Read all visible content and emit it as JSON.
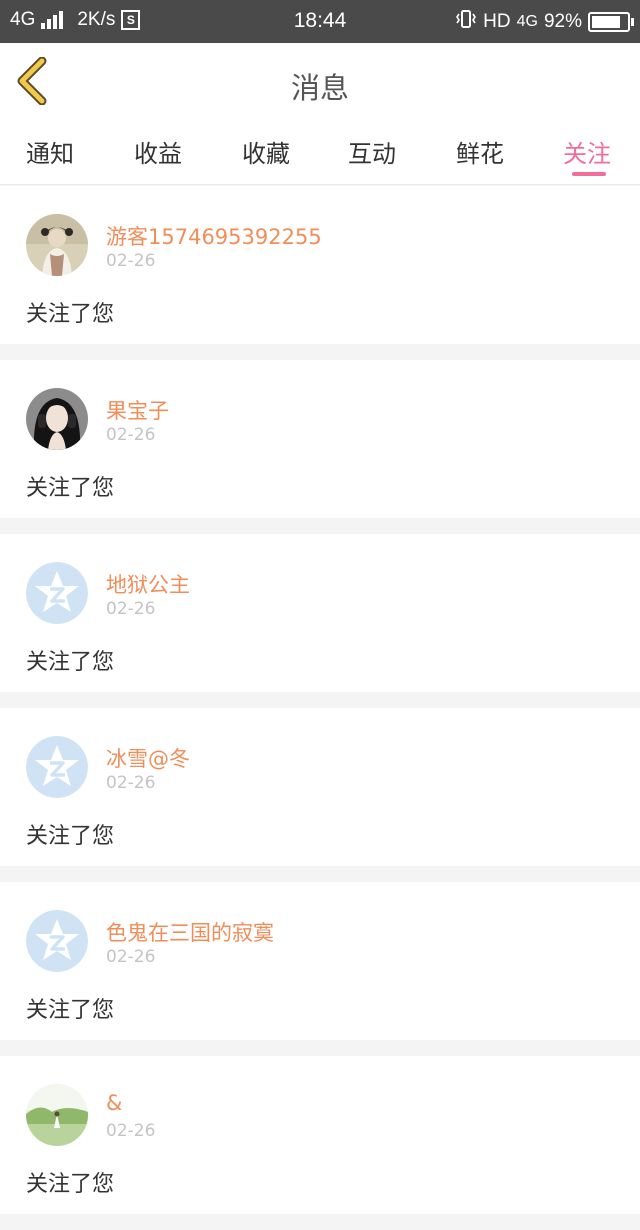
{
  "status_bar": {
    "network": "4G",
    "speed": "2K/s",
    "time": "18:44",
    "hd": "HD",
    "network_right": "4G",
    "battery": "92%",
    "battery_level": 0.92
  },
  "header": {
    "title": "消息",
    "back_icon": "chevron-left-icon"
  },
  "tabs": [
    "通知",
    "收益",
    "收藏",
    "互动",
    "鲜花",
    "关注"
  ],
  "active_tab": "关注",
  "colors": {
    "accent": "#f06d9c",
    "username": "#f08e5a",
    "back_arrow": "#f3c94a",
    "status_bar": "#4a4a4a",
    "placeholder_avatar": "#cfe3f5"
  },
  "notifications": [
    {
      "name": "游客1574695392255",
      "date": "02-26",
      "text": "关注了您",
      "avatar": "photo-woman-traditional"
    },
    {
      "name": "果宝子",
      "date": "02-26",
      "text": "关注了您",
      "avatar": "photo-woman-headphones"
    },
    {
      "name": "地狱公主",
      "date": "02-26",
      "text": "关注了您",
      "avatar": "qzone-star-placeholder-icon"
    },
    {
      "name": "冰雪@冬",
      "date": "02-26",
      "text": "关注了您",
      "avatar": "qzone-star-placeholder-icon"
    },
    {
      "name": "色鬼在三国的寂寞",
      "date": "02-26",
      "text": "关注了您",
      "avatar": "qzone-star-placeholder-icon"
    },
    {
      "name": "&",
      "date": "02-26",
      "text": "关注了您",
      "avatar": "photo-landscape"
    }
  ]
}
